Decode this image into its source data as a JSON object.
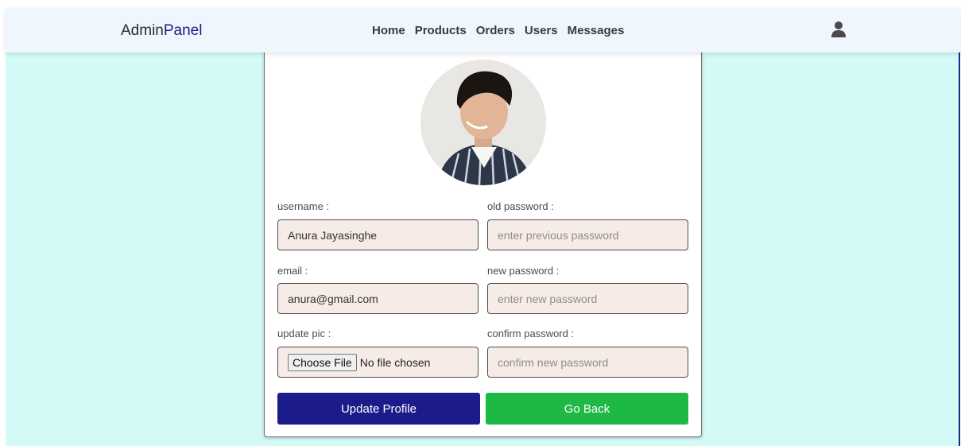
{
  "brand": {
    "prefix": "Admin",
    "accent": "Panel"
  },
  "nav": [
    "Home",
    "Products",
    "Orders",
    "Users",
    "Messages"
  ],
  "form": {
    "username": {
      "label": "username :",
      "value": "Anura Jayasinghe"
    },
    "email": {
      "label": "email :",
      "value": "anura@gmail.com"
    },
    "update_pic": {
      "label": "update pic :",
      "button": "Choose File",
      "status": "No file chosen"
    },
    "old_password": {
      "label": "old password :",
      "placeholder": "enter previous password"
    },
    "new_password": {
      "label": "new password :",
      "placeholder": "enter new password"
    },
    "confirm_password": {
      "label": "confirm password :",
      "placeholder": "confirm new password"
    }
  },
  "buttons": {
    "update": "Update Profile",
    "back": "Go Back"
  },
  "colors": {
    "background": "#d3faf6",
    "navbar": "#f0f6fd",
    "primary": "#1b1b8a",
    "success": "#1db944",
    "input_bg": "#f7ebe7"
  },
  "icons": {
    "user": "user-icon"
  }
}
